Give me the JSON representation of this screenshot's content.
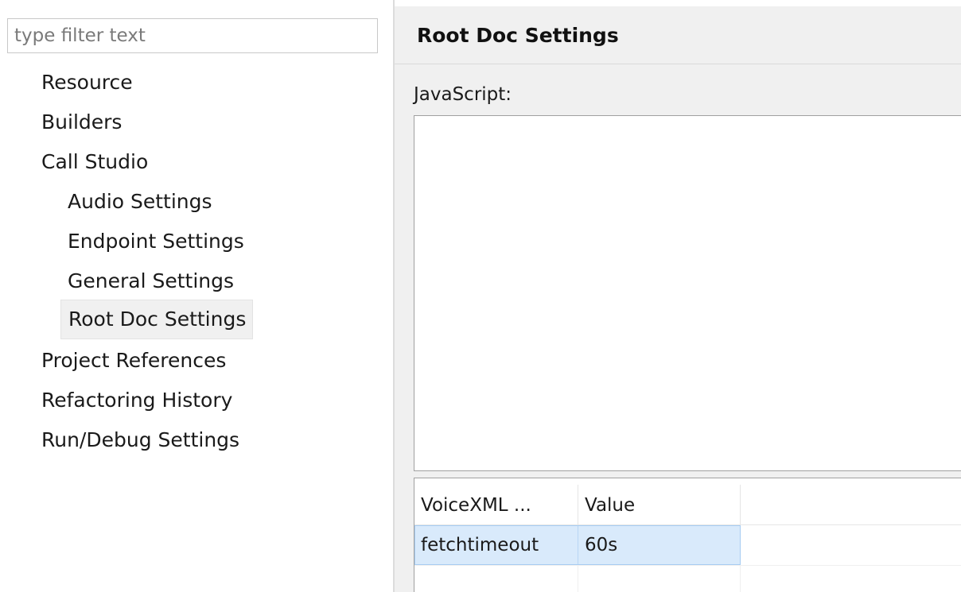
{
  "filter": {
    "placeholder": "type filter text"
  },
  "tree": {
    "items": [
      {
        "label": "Resource"
      },
      {
        "label": "Builders"
      },
      {
        "label": "Call Studio"
      },
      {
        "label": "Audio Settings"
      },
      {
        "label": "Endpoint Settings"
      },
      {
        "label": "General Settings"
      },
      {
        "label": "Root Doc Settings",
        "selected": true
      },
      {
        "label": "Project References"
      },
      {
        "label": "Refactoring History"
      },
      {
        "label": "Run/Debug Settings"
      }
    ]
  },
  "page": {
    "title": "Root Doc Settings",
    "javascript_label": "JavaScript:",
    "javascript_value": ""
  },
  "table": {
    "columns": [
      "VoiceXML ...",
      "Value"
    ],
    "rows": [
      {
        "name": "fetchtimeout",
        "value": "60s",
        "selected": true
      },
      {
        "name": "",
        "value": ""
      }
    ]
  },
  "colors": {
    "selection_row": "#d9eafb",
    "selected_tree_item": "#f0f0f0",
    "page_background": "#f0f0f0"
  }
}
